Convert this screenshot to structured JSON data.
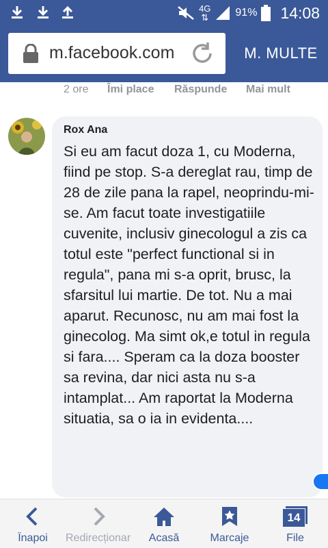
{
  "status_bar": {
    "network": "4G",
    "battery": "91%",
    "time": "14:08"
  },
  "browser": {
    "url": "m.facebook.com",
    "more_label": "M. MULTE"
  },
  "prev_comment_actions": {
    "time": "2 ore",
    "like": "Îmi place",
    "reply": "Răspunde",
    "more": "Mai mult"
  },
  "comment": {
    "author": "Rox Ana",
    "text": "Si eu am facut doza 1, cu Moderna, fiind pe stop. S-a dereglat rau, timp de 28 de zile pana la rapel, neoprindu-mi-se. Am facut toate investigatiile cuvenite, inclusiv ginecologul a zis ca totul este \"perfect functional si in regula\", pana mi s-a oprit, brusc, la sfarsitul lui martie. De tot. Nu a mai aparut. Recunosc, nu am mai fost la ginecolog. Ma simt ok,e totul in regula si fara.... Speram ca la doza booster sa revina, dar nici asta nu s-a intamplat... Am raportat la Moderna situatia, sa o ia in evidenta...."
  },
  "bottom_nav": {
    "back": "Înapoi",
    "forward": "Redirecționare",
    "home": "Acasă",
    "bookmarks": "Marcaje",
    "tabs": "File",
    "tab_count": "14"
  },
  "colors": {
    "brand": "#3b5998",
    "bubble": "#f0f2f5",
    "muted": "#90949c"
  }
}
